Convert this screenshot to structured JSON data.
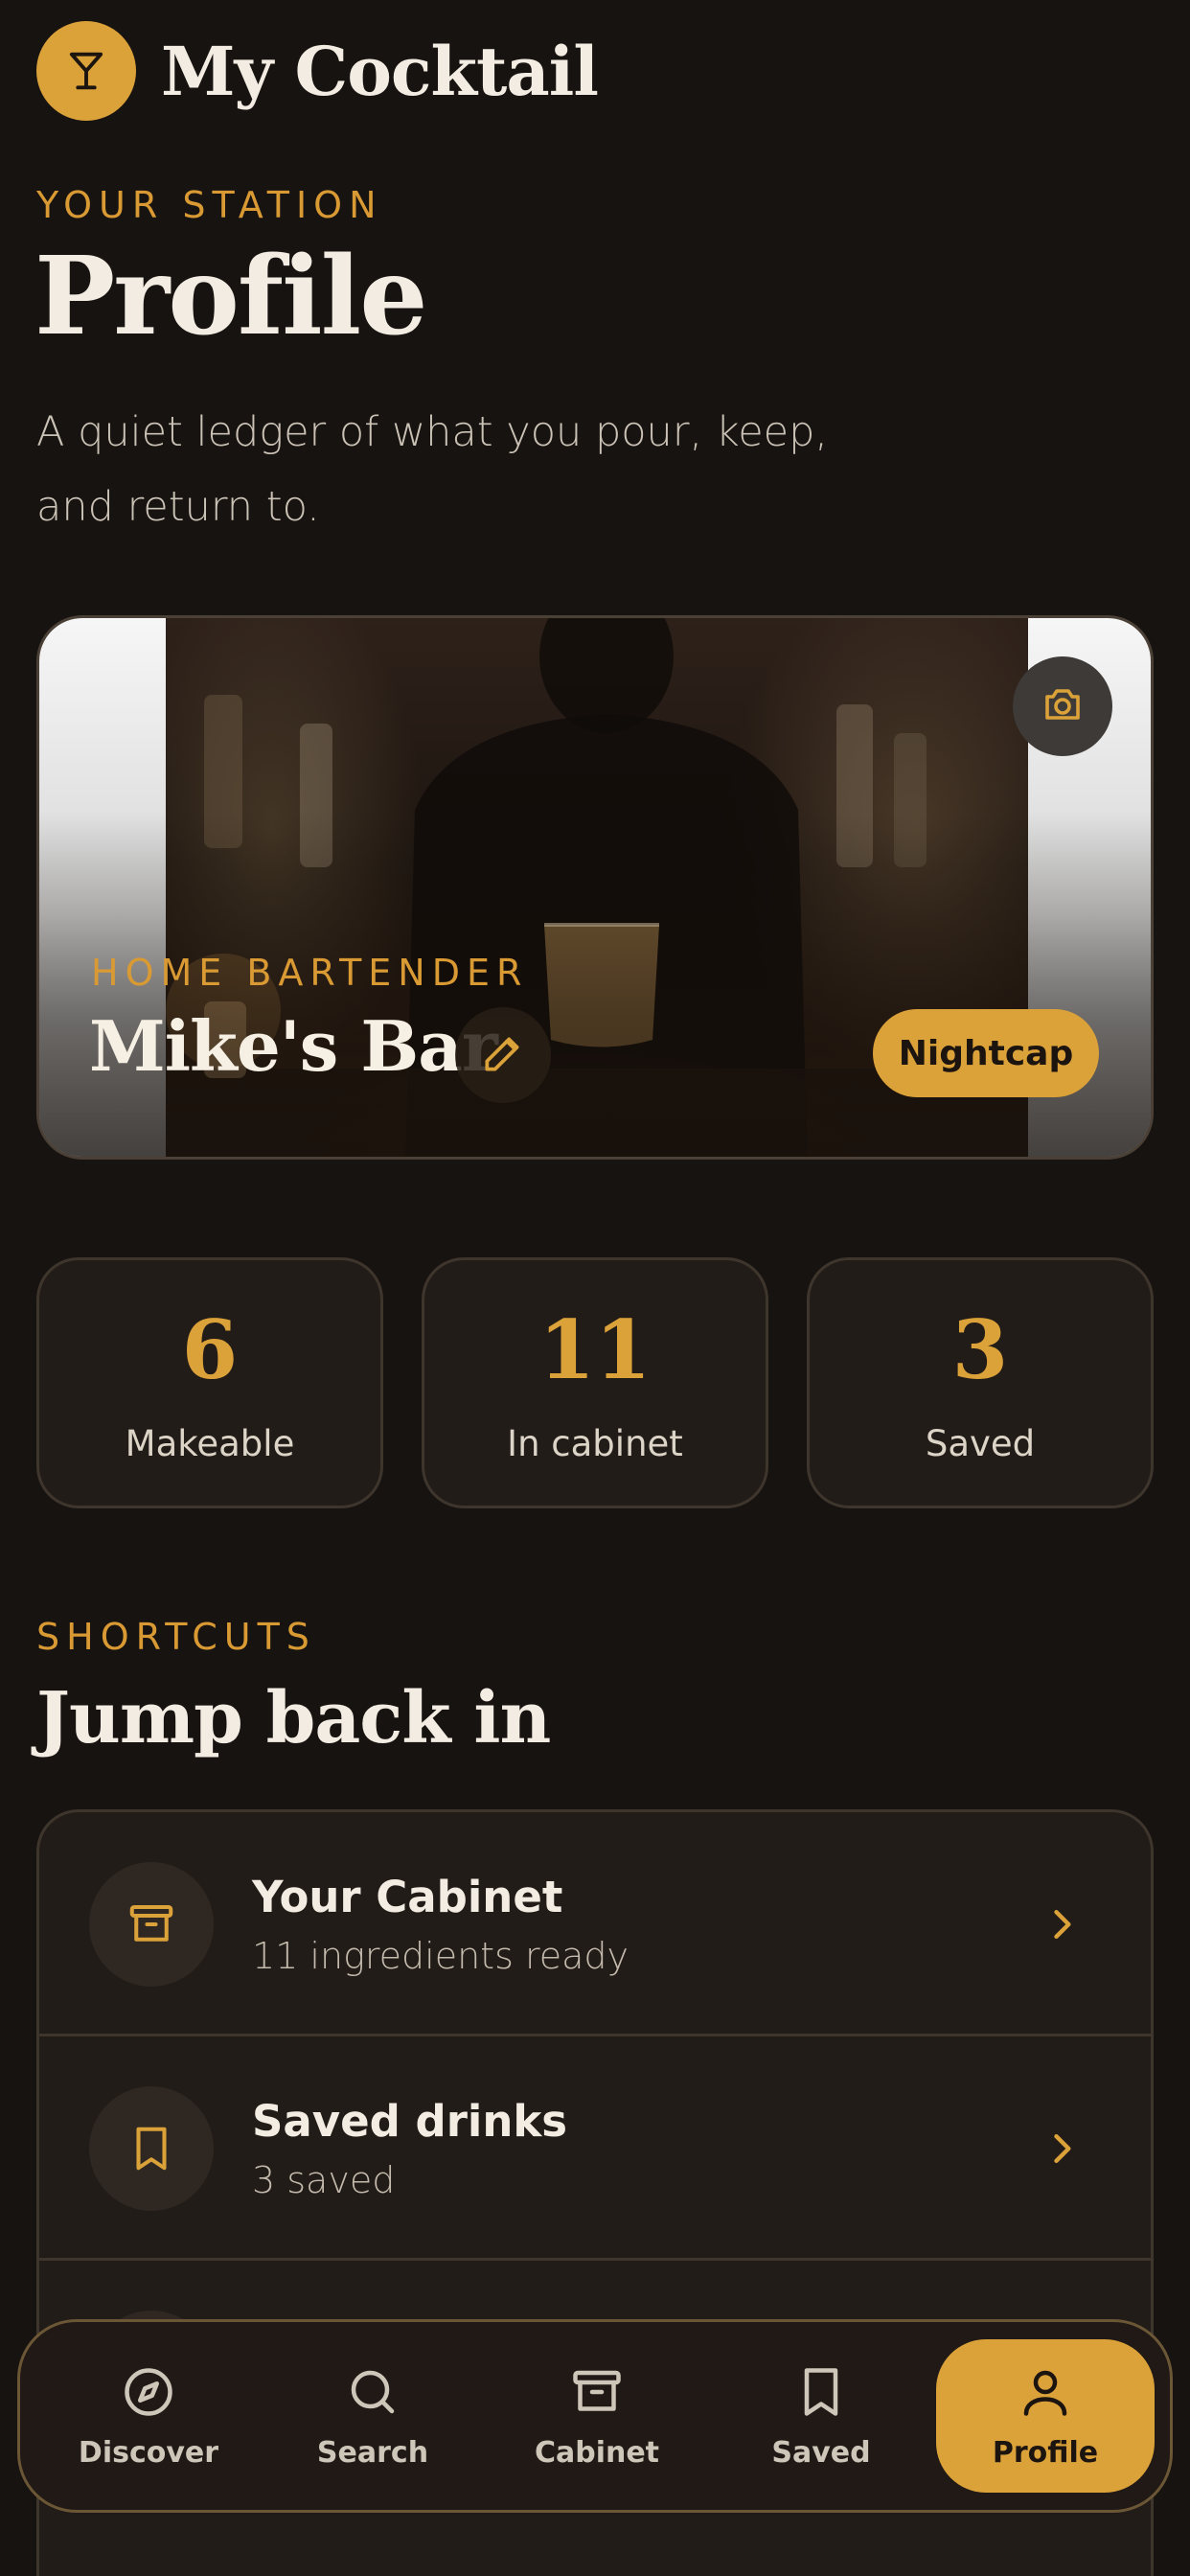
{
  "app": {
    "title": "My Cocktail",
    "logo_icon": "cocktail-glass-icon",
    "accent": "#dca23a"
  },
  "header": {
    "eyebrow": "YOUR STATION",
    "title": "Profile",
    "subtitle": "A quiet ledger of what you pour, keep, and return to."
  },
  "hero": {
    "role": "HOME BARTENDER",
    "name": "Mike's Bar",
    "badge": "Nightcap",
    "camera_icon": "camera-icon",
    "edit_icon": "pencil-icon"
  },
  "stats": [
    {
      "value": "6",
      "label": "Makeable"
    },
    {
      "value": "11",
      "label": "In cabinet"
    },
    {
      "value": "3",
      "label": "Saved"
    }
  ],
  "shortcuts": {
    "eyebrow": "SHORTCUTS",
    "title": "Jump back in",
    "items": [
      {
        "title": "Your Cabinet",
        "subtitle": "11 ingredients ready",
        "icon": "archive-box-icon"
      },
      {
        "title": "Saved drinks",
        "subtitle": "3 saved",
        "icon": "bookmark-icon"
      }
    ]
  },
  "nav": {
    "items": [
      {
        "label": "Discover",
        "icon": "compass-icon"
      },
      {
        "label": "Search",
        "icon": "search-icon"
      },
      {
        "label": "Cabinet",
        "icon": "archive-box-icon"
      },
      {
        "label": "Saved",
        "icon": "bookmark-icon"
      },
      {
        "label": "Profile",
        "icon": "user-icon",
        "active": true
      }
    ]
  }
}
